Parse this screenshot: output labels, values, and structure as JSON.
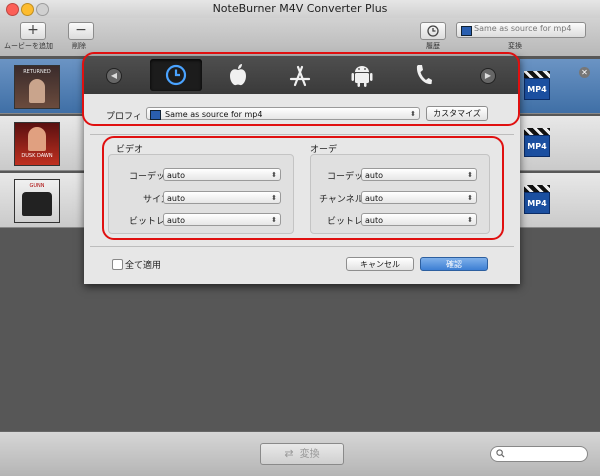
{
  "window": {
    "title": "NoteBurner M4V Converter Plus"
  },
  "toolbar": {
    "add_label": "ムービーを追加",
    "delete_label": "削除",
    "history_label": "履歴",
    "convert_label": "変換",
    "output_format": "Same as source for mp4"
  },
  "list": {
    "items": [
      {
        "thumb_title": "RETURNED",
        "format": "MP4"
      },
      {
        "thumb_title": "DUSK DAWN",
        "format": "MP4"
      },
      {
        "thumb_title": "GUNN",
        "format": "MP4"
      }
    ]
  },
  "dialog": {
    "profile_label": "プロフィ",
    "profile_value": "Same as source for mp4",
    "customize_label": "カスタマイズ",
    "video": {
      "title": "ビデオ",
      "codec_label": "コーデッ",
      "codec_value": "auto",
      "size_label": "サイズ",
      "size_value": "auto",
      "bitrate_label": "ビットレ",
      "bitrate_value": "auto"
    },
    "audio": {
      "title": "オーデ",
      "codec_label": "コーデッ",
      "codec_value": "auto",
      "channel_label": "チャンネル",
      "channel_value": "auto",
      "bitrate_label": "ビットレ",
      "bitrate_value": "auto"
    },
    "apply_all_label": "全て適用",
    "cancel_label": "キャンセル",
    "ok_label": "確認"
  },
  "bottom": {
    "convert_label": "変換"
  }
}
